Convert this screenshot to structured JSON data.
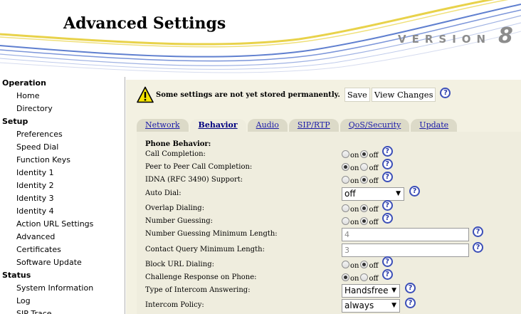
{
  "header": {
    "title": "Advanced Settings",
    "version_label": "VERSION",
    "version_number": "8"
  },
  "sidebar": {
    "groups": [
      {
        "label": "Operation",
        "items": [
          "Home",
          "Directory"
        ]
      },
      {
        "label": "Setup",
        "items": [
          "Preferences",
          "Speed Dial",
          "Function Keys",
          "Identity 1",
          "Identity 2",
          "Identity 3",
          "Identity 4",
          "Action URL Settings",
          "Advanced",
          "Certificates",
          "Software Update"
        ]
      },
      {
        "label": "Status",
        "items": [
          "System Information",
          "Log",
          "SIP Trace"
        ]
      }
    ]
  },
  "notice": {
    "text": "Some settings are not yet stored permanently.",
    "save_label": "Save",
    "view_changes_label": "View Changes",
    "help": "?"
  },
  "tabs": [
    {
      "label": "Network",
      "active": false
    },
    {
      "label": "Behavior",
      "active": true
    },
    {
      "label": "Audio",
      "active": false
    },
    {
      "label": "SIP/RTP",
      "active": false
    },
    {
      "label": "QoS/Security",
      "active": false
    },
    {
      "label": "Update",
      "active": false
    }
  ],
  "section": {
    "title": "Phone Behavior:",
    "radio_on": "on",
    "radio_off": "off",
    "help": "?",
    "rows": [
      {
        "label": "Call Completion:",
        "type": "radio",
        "value": "off"
      },
      {
        "label": "Peer to Peer Call Completion:",
        "type": "radio",
        "value": "on"
      },
      {
        "label": "IDNA (RFC 3490) Support:",
        "type": "radio",
        "value": "off"
      },
      {
        "label": "Auto Dial:",
        "type": "select",
        "value": "off"
      },
      {
        "label": "Overlap Dialing:",
        "type": "radio",
        "value": "off"
      },
      {
        "label": "Number Guessing:",
        "type": "radio",
        "value": "off"
      },
      {
        "label": "Number Guessing Minimum Length:",
        "type": "text",
        "value": "4"
      },
      {
        "label": "Contact Query Minimum Length:",
        "type": "text",
        "value": "3"
      },
      {
        "label": "Block URL Dialing:",
        "type": "radio",
        "value": "off"
      },
      {
        "label": "Challenge Response on Phone:",
        "type": "radio",
        "value": "on"
      },
      {
        "label": "Type of Intercom Answering:",
        "type": "select",
        "value": "Handsfree"
      },
      {
        "label": "Intercom Policy:",
        "type": "select",
        "value": "always"
      }
    ]
  },
  "colors": {
    "main_background": "#f3f1e2",
    "tab_link": "#1a1aa8",
    "help_icon": "#3c4fb8",
    "version_text": "#8c8c8c"
  }
}
